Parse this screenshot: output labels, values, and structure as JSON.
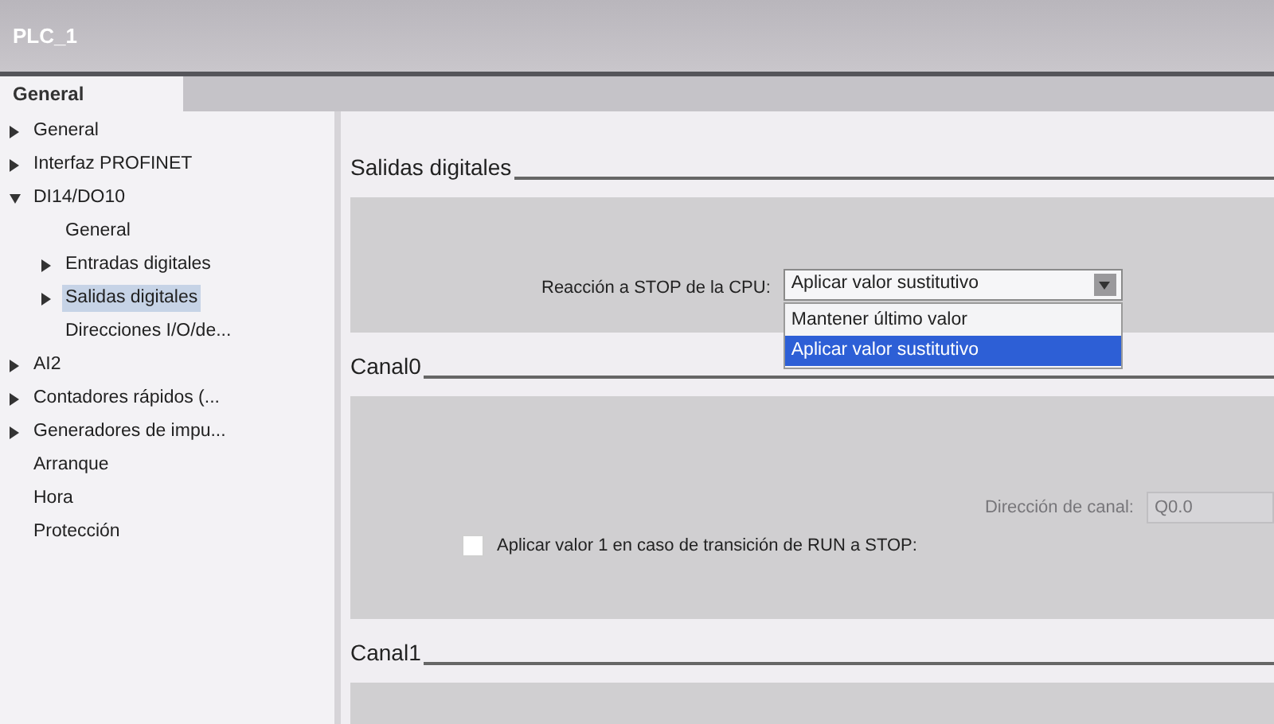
{
  "window": {
    "title": "PLC_1"
  },
  "tabs": [
    {
      "label": "General",
      "selected": true
    }
  ],
  "sidebar": {
    "items": [
      {
        "label": "General",
        "kind": "group",
        "expanded": false,
        "selected": false
      },
      {
        "label": "Interfaz PROFINET",
        "kind": "group",
        "expanded": false,
        "selected": false
      },
      {
        "label": "DI14/DO10",
        "kind": "group",
        "expanded": true,
        "selected": false,
        "children": [
          {
            "label": "General",
            "kind": "leaf",
            "selected": false
          },
          {
            "label": "Entradas digitales",
            "kind": "group",
            "expanded": false,
            "selected": false
          },
          {
            "label": "Salidas digitales",
            "kind": "group",
            "expanded": false,
            "selected": true
          },
          {
            "label": "Direcciones I/O/de...",
            "kind": "leaf",
            "selected": false
          }
        ]
      },
      {
        "label": "AI2",
        "kind": "group",
        "expanded": false,
        "selected": false
      },
      {
        "label": "Contadores rápidos (...",
        "kind": "group",
        "expanded": false,
        "selected": false
      },
      {
        "label": "Generadores de impu...",
        "kind": "group",
        "expanded": false,
        "selected": false
      },
      {
        "label": "Arranque",
        "kind": "leaf",
        "selected": false
      },
      {
        "label": "Hora",
        "kind": "leaf",
        "selected": false
      },
      {
        "label": "Protección",
        "kind": "leaf",
        "selected": false
      }
    ]
  },
  "sections": [
    {
      "title": "Salidas digitales",
      "reaction": {
        "label": "Reacción a STOP de la CPU:",
        "value": "Aplicar valor sustitutivo",
        "expanded": true,
        "options": [
          {
            "label": "Mantener último valor",
            "selected": false
          },
          {
            "label": "Aplicar valor sustitutivo",
            "selected": true
          }
        ]
      }
    },
    {
      "title": "Canal0",
      "address": {
        "label": "Dirección de canal:",
        "value": "Q0.0",
        "disabled": true
      },
      "checkbox": {
        "label": "Aplicar valor 1 en caso de transición de RUN a STOP:",
        "checked": false
      }
    },
    {
      "title": "Canal1"
    }
  ]
}
